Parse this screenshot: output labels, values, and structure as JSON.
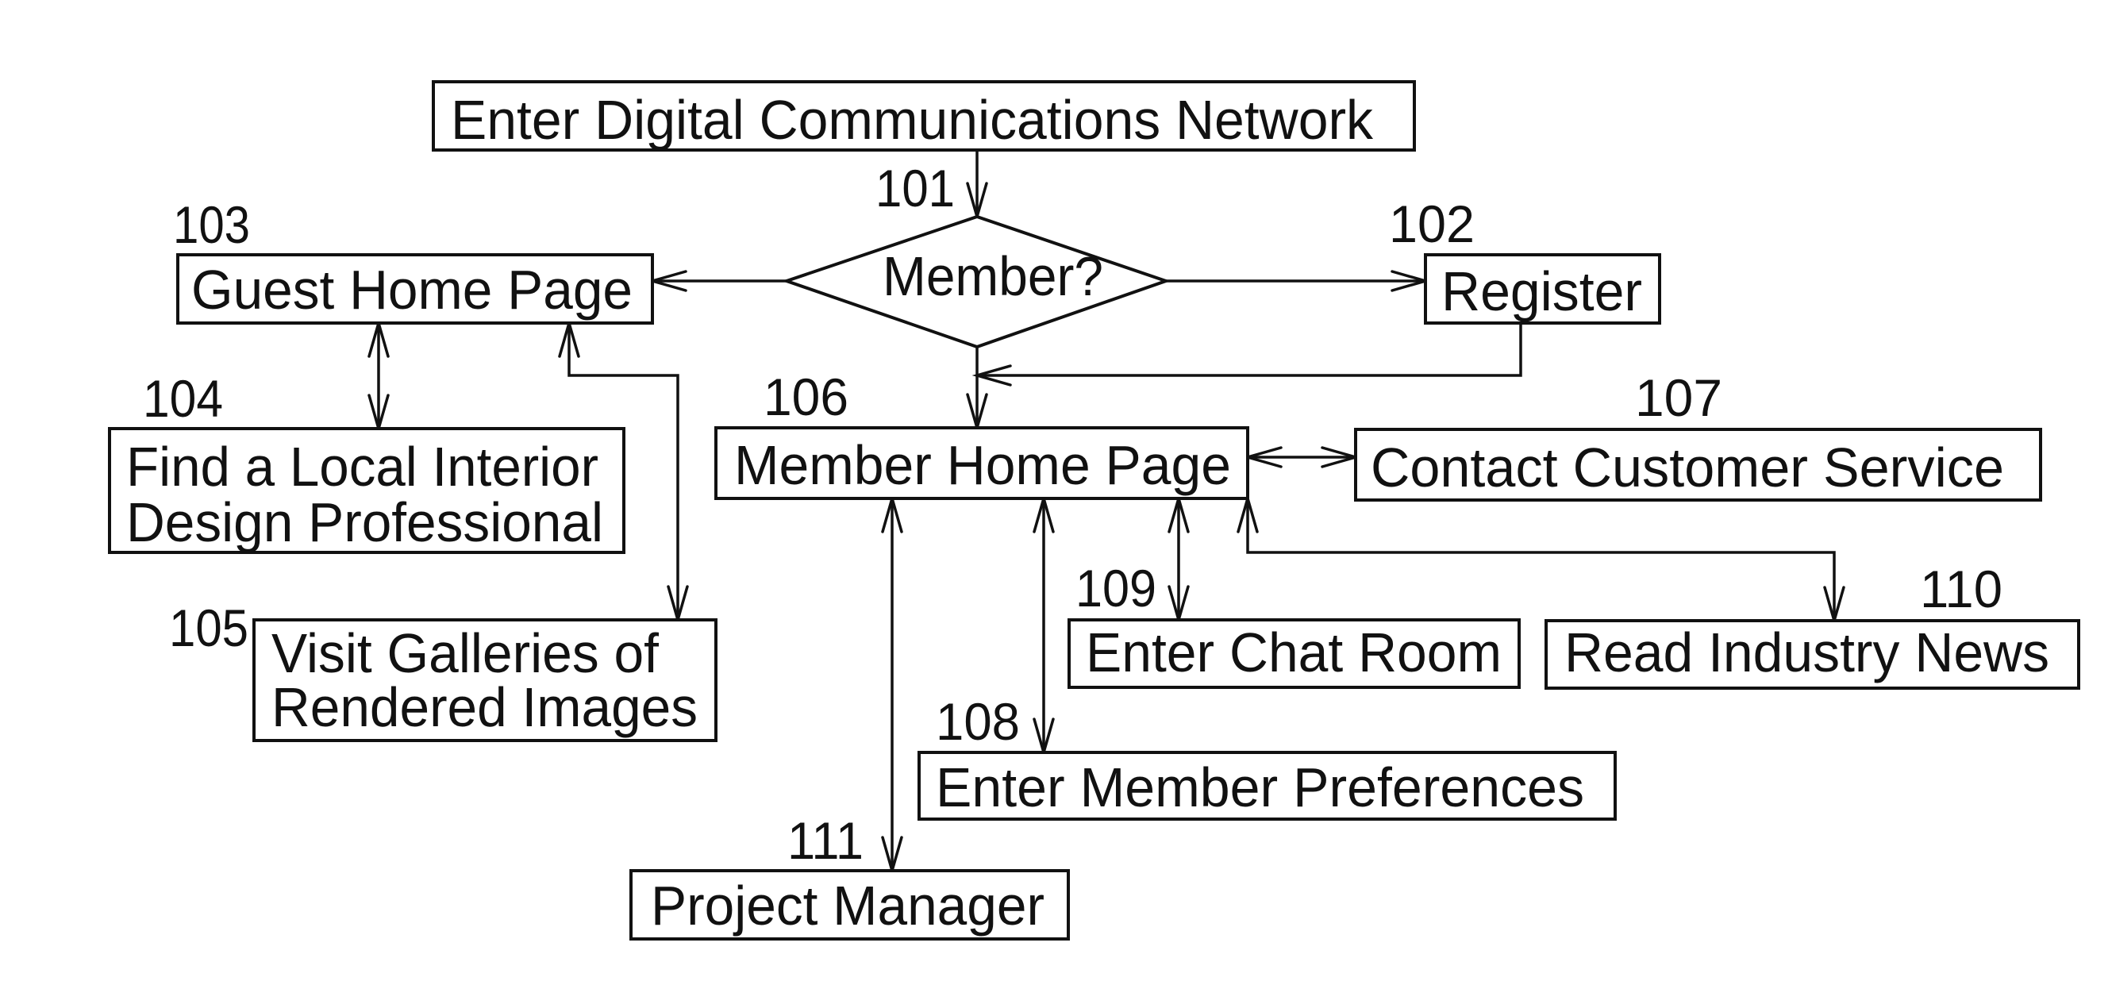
{
  "diagram": {
    "type": "flowchart",
    "colors": {
      "ink": "#111111",
      "background": "#ffffff"
    },
    "nodes": {
      "entry": {
        "ref": "",
        "lines": [
          "Enter Digital Communications Network"
        ]
      },
      "member_q": {
        "ref": "101",
        "lines": [
          "Member?"
        ],
        "shape": "decision"
      },
      "register": {
        "ref": "102",
        "lines": [
          "Register"
        ]
      },
      "guest_home": {
        "ref": "103",
        "lines": [
          "Guest Home Page"
        ]
      },
      "find_pro": {
        "ref": "104",
        "lines": [
          "Find a Local Interior",
          "Design Professional"
        ]
      },
      "galleries": {
        "ref": "105",
        "lines": [
          "Visit Galleries of",
          "Rendered Images"
        ]
      },
      "member_home": {
        "ref": "106",
        "lines": [
          "Member Home Page"
        ]
      },
      "customer_svc": {
        "ref": "107",
        "lines": [
          "Contact Customer Service"
        ]
      },
      "preferences": {
        "ref": "108",
        "lines": [
          "Enter Member Preferences"
        ]
      },
      "chat": {
        "ref": "109",
        "lines": [
          "Enter Chat Room"
        ]
      },
      "news": {
        "ref": "110",
        "lines": [
          "Read Industry News"
        ]
      },
      "project_mgr": {
        "ref": "111",
        "lines": [
          "Project Manager"
        ]
      }
    },
    "edges": [
      {
        "from": "entry",
        "to": "member_q",
        "direction": "forward"
      },
      {
        "from": "member_q",
        "to": "guest_home",
        "direction": "forward"
      },
      {
        "from": "member_q",
        "to": "register",
        "direction": "forward"
      },
      {
        "from": "member_q",
        "to": "member_home",
        "direction": "forward"
      },
      {
        "from": "register",
        "to": "member_home",
        "direction": "forward"
      },
      {
        "from": "guest_home",
        "to": "find_pro",
        "direction": "both"
      },
      {
        "from": "guest_home",
        "to": "galleries",
        "direction": "both"
      },
      {
        "from": "member_home",
        "to": "customer_svc",
        "direction": "both"
      },
      {
        "from": "member_home",
        "to": "project_mgr",
        "direction": "both"
      },
      {
        "from": "member_home",
        "to": "preferences",
        "direction": "both"
      },
      {
        "from": "member_home",
        "to": "chat",
        "direction": "both"
      },
      {
        "from": "member_home",
        "to": "news",
        "direction": "both"
      }
    ]
  }
}
